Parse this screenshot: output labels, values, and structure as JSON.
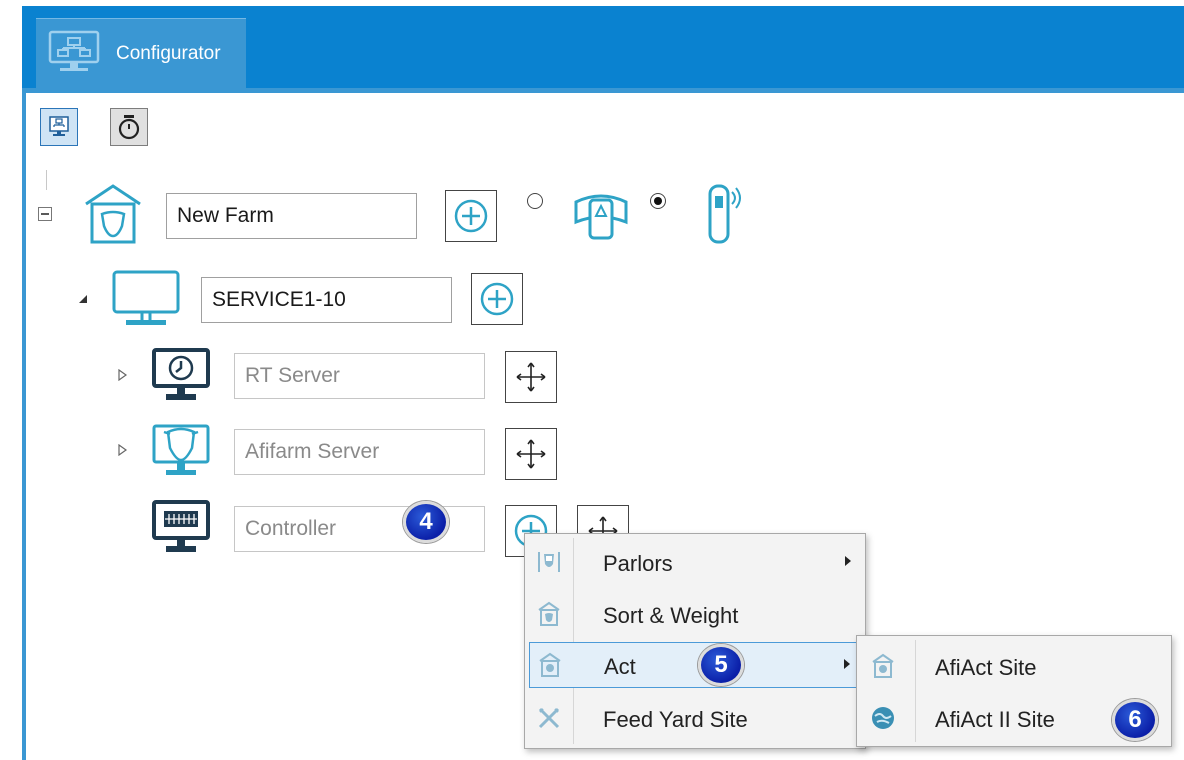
{
  "tab": {
    "label": "Configurator",
    "icon": "configurator-icon"
  },
  "toolbar": {
    "buttons": [
      {
        "icon": "configurator-icon",
        "active": true
      },
      {
        "icon": "stopwatch-icon",
        "active": false
      }
    ]
  },
  "tree": {
    "farm": {
      "name": "New Farm",
      "icon": "farm-barn-icon",
      "add_icon": "add-circle-icon"
    },
    "device_choice": {
      "options": [
        "collar-icon",
        "pedometer-tag-icon"
      ],
      "selected": 1
    },
    "computer": {
      "name": "SERVICE1-10",
      "icon": "computer-monitor-icon",
      "add_icon": "add-circle-icon"
    },
    "nodes": [
      {
        "name": "RT Server",
        "icon": "rt-server-clock-icon",
        "action_icon": "move-icon"
      },
      {
        "name": "Afifarm Server",
        "icon": "afifarm-server-cow-icon",
        "action_icon": "move-icon"
      },
      {
        "name": "Controller",
        "icon": "controller-keyboard-icon",
        "action_icon": "move-icon"
      }
    ]
  },
  "badges": {
    "controller": "4",
    "act": "5",
    "afiact_ii": "6"
  },
  "context_menu": {
    "items": [
      {
        "label": "Parlors",
        "icon": "parlor-icon",
        "has_submenu": true
      },
      {
        "label": "Sort & Weight",
        "icon": "sort-weight-icon",
        "has_submenu": false
      },
      {
        "label": "Act",
        "icon": "act-icon",
        "has_submenu": true,
        "highlighted": true
      },
      {
        "label": "Feed Yard Site",
        "icon": "feed-yard-icon",
        "has_submenu": false
      }
    ]
  },
  "submenu": {
    "items": [
      {
        "label": "AfiAct Site",
        "icon": "afiact-site-icon"
      },
      {
        "label": "AfiAct II Site",
        "icon": "afiact-ii-site-icon"
      }
    ]
  },
  "colors": {
    "titlebar": "#0a82d0",
    "tab": "#3a97d3",
    "icon_teal": "#2ea3c6",
    "icon_dark": "#1f3a4f"
  }
}
